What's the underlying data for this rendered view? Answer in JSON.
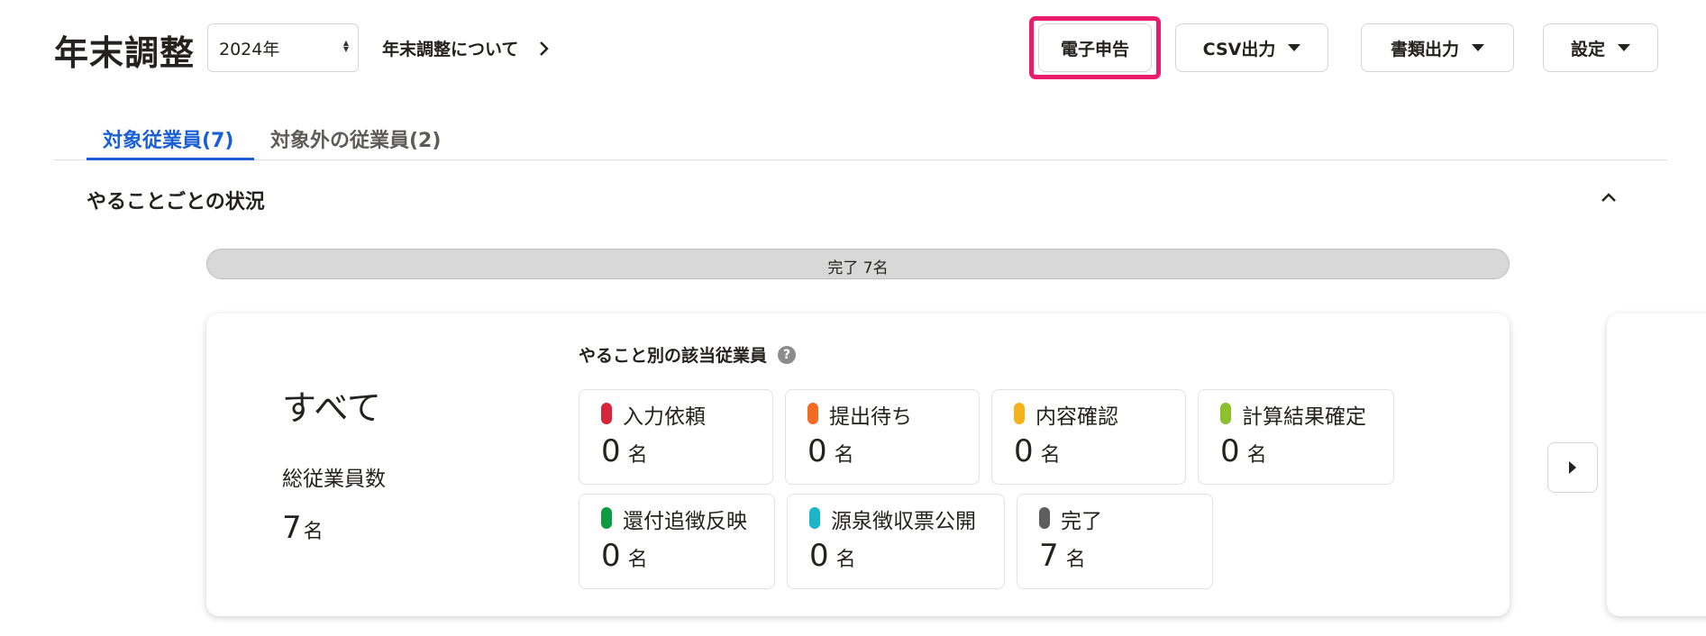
{
  "header": {
    "title": "年末調整",
    "year_select": {
      "value": "2024年"
    },
    "about_link": "年末調整について",
    "buttons": {
      "e_filing": "電子申告",
      "csv_export": "CSV出力",
      "document_export": "書類出力",
      "settings": "設定"
    },
    "highlight_color": "#ec1c6c"
  },
  "tabs": [
    {
      "label": "対象従業員(7)",
      "active": true
    },
    {
      "label": "対象外の従業員(2)",
      "active": false
    }
  ],
  "accent_color": "#1a5fd6",
  "section": {
    "title": "やることごとの状況",
    "progress": {
      "label": "完了 7名",
      "completed_fraction": 1.0
    },
    "card": {
      "all_title": "すべて",
      "total_label": "総従業員数",
      "total_value": "7",
      "total_unit": "名",
      "task_heading": "やること別の該当従業員",
      "help_icon": "question-circle-icon",
      "statuses": [
        {
          "label": "入力依頼",
          "count": "0",
          "unit": "名",
          "color": "#d6263b"
        },
        {
          "label": "提出待ち",
          "count": "0",
          "unit": "名",
          "color": "#f26b21"
        },
        {
          "label": "内容確認",
          "count": "0",
          "unit": "名",
          "color": "#f6b21b"
        },
        {
          "label": "計算結果確定",
          "count": "0",
          "unit": "名",
          "color": "#8cc02c"
        },
        {
          "label": "還付追徴反映",
          "count": "0",
          "unit": "名",
          "color": "#0e9a41"
        },
        {
          "label": "源泉徴収票公開",
          "count": "0",
          "unit": "名",
          "color": "#1bb5c5"
        },
        {
          "label": "完了",
          "count": "7",
          "unit": "名",
          "color": "#5e5e5e"
        }
      ]
    }
  }
}
